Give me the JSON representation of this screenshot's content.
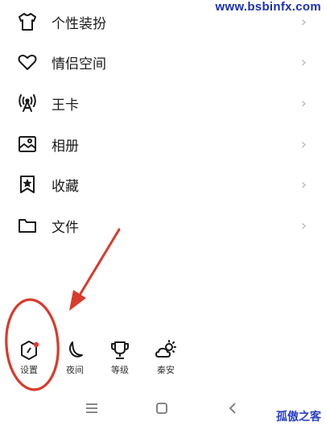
{
  "watermark_top": "www.bsbinfx.com",
  "watermark_bottom": "孤傲之客",
  "menu": {
    "items": [
      {
        "label": "个性装扮",
        "icon": "tshirt-icon"
      },
      {
        "label": "情侣空间",
        "icon": "heart-icon"
      },
      {
        "label": "王卡",
        "icon": "signal-tower-icon"
      },
      {
        "label": "相册",
        "icon": "photo-album-icon"
      },
      {
        "label": "收藏",
        "icon": "bookmark-star-icon"
      },
      {
        "label": "文件",
        "icon": "folder-icon"
      }
    ],
    "chevron": "›"
  },
  "bottom_actions": [
    {
      "label": "设置",
      "icon": "settings-hexagon-icon"
    },
    {
      "label": "夜间",
      "icon": "moon-icon"
    },
    {
      "label": "等级",
      "icon": "trophy-icon"
    },
    {
      "label": "秦安",
      "icon": "weather-cloud-sun-icon"
    }
  ],
  "colors": {
    "annotation_red": "#d93a2b",
    "notification_dot": "#e53935",
    "watermark_blue": "#1b2fb3"
  }
}
